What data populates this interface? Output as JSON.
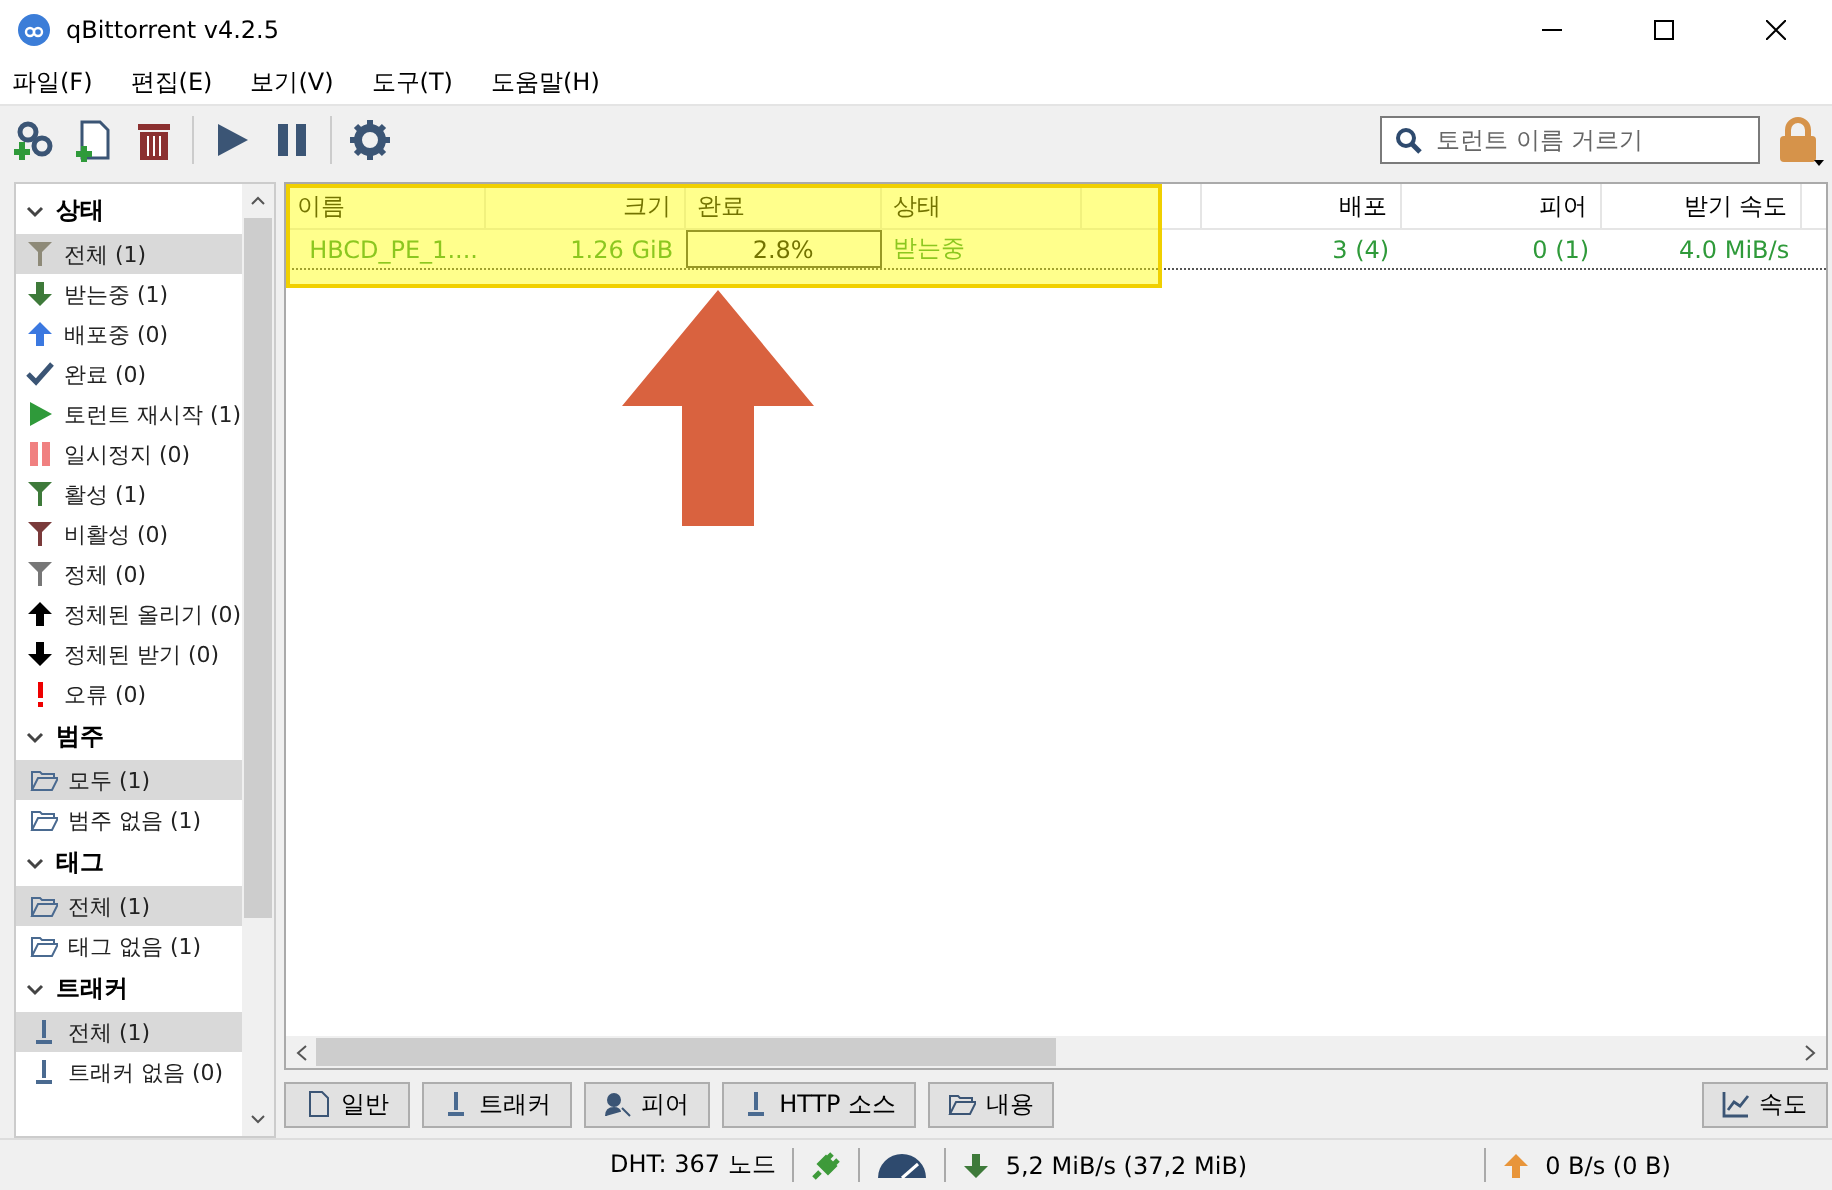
{
  "window": {
    "title": "qBittorrent v4.2.5"
  },
  "menu": [
    "파일(F)",
    "편집(E)",
    "보기(V)",
    "도구(T)",
    "도움말(H)"
  ],
  "search": {
    "placeholder": "토런트 이름 거르기"
  },
  "sidebar": [
    {
      "title": "상태",
      "expanded": true,
      "items": [
        {
          "kind": "all",
          "label": "전체 (1)",
          "selected": true
        },
        {
          "kind": "down",
          "label": "받는중 (1)",
          "selected": false
        },
        {
          "kind": "up",
          "label": "배포중 (0)",
          "selected": false
        },
        {
          "kind": "check",
          "label": "완료 (0)",
          "selected": false
        },
        {
          "kind": "play",
          "label": "토런트 재시작 (1)",
          "selected": false
        },
        {
          "kind": "pause",
          "label": "일시정지 (0)",
          "selected": false
        },
        {
          "kind": "active",
          "label": "활성 (1)",
          "selected": false
        },
        {
          "kind": "inactive",
          "label": "비활성 (0)",
          "selected": false
        },
        {
          "kind": "stalled",
          "label": "정체 (0)",
          "selected": false
        },
        {
          "kind": "stup",
          "label": "정체된 올리기 (0)",
          "selected": false
        },
        {
          "kind": "stdown",
          "label": "정체된 받기 (0)",
          "selected": false
        },
        {
          "kind": "error",
          "label": "오류 (0)",
          "selected": false
        }
      ]
    },
    {
      "title": "범주",
      "expanded": true,
      "items": [
        {
          "kind": "folder",
          "label": "모두 (1)",
          "selected": true
        },
        {
          "kind": "folder",
          "label": "범주 없음 (1)",
          "selected": false
        }
      ]
    },
    {
      "title": "태그",
      "expanded": true,
      "items": [
        {
          "kind": "folder",
          "label": "전체 (1)",
          "selected": true
        },
        {
          "kind": "folder",
          "label": "태그 없음 (1)",
          "selected": false
        }
      ]
    },
    {
      "title": "트래커",
      "expanded": true,
      "items": [
        {
          "kind": "tracker",
          "label": "전체 (1)",
          "selected": true
        },
        {
          "kind": "tracker",
          "label": "트래커 없음 (0)",
          "selected": false
        }
      ]
    }
  ],
  "table": {
    "columns": [
      "이름",
      "크기",
      "완료",
      "상태",
      "배포",
      "피어",
      "받기 속도"
    ],
    "rows": [
      {
        "name": "HBCD_PE_1....",
        "size": "1.26 GiB",
        "progress": "2.8%",
        "status": "받는중",
        "seeds": "3 (4)",
        "peers": "0 (1)",
        "down_speed": "4.0 MiB/s"
      }
    ]
  },
  "detail_tabs": [
    "일반",
    "트래커",
    "피어",
    "HTTP 소스",
    "내용"
  ],
  "speed_button": "속도",
  "status_bar": {
    "dht": "DHT: 367 노드",
    "download": "5,2 MiB/s (37,2 MiB)",
    "upload": "0 B/s (0 B)"
  }
}
